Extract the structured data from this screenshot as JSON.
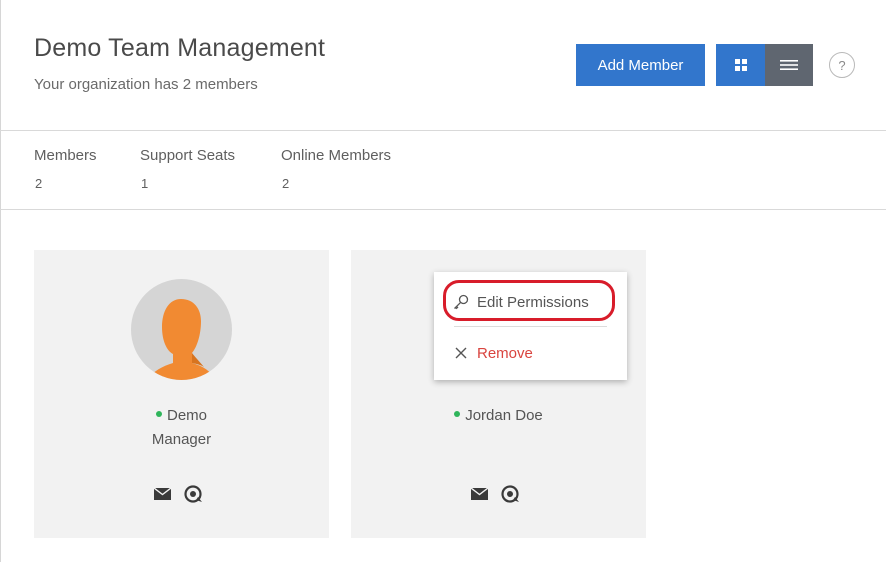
{
  "header": {
    "title": "Demo Team Management",
    "subtitle": "Your organization has 2 members",
    "add_member_label": "Add Member",
    "grid_view_icon": "grid-icon",
    "list_view_icon": "list-icon",
    "help_label": "?"
  },
  "stats": [
    {
      "label": "Members",
      "value": "2"
    },
    {
      "label": "Support Seats",
      "value": "1"
    },
    {
      "label": "Online Members",
      "value": "2"
    }
  ],
  "members": [
    {
      "name": "Demo",
      "role": "Manager",
      "status": "online",
      "actions": [
        "mail-icon",
        "support-icon"
      ]
    },
    {
      "name": "Jordan Doe",
      "status": "online",
      "actions": [
        "mail-icon",
        "support-icon"
      ]
    }
  ],
  "menu": {
    "edit_permissions": "Edit Permissions",
    "remove": "Remove"
  },
  "colors": {
    "primary": "#3276cc",
    "list_toggle": "#5f6670",
    "online": "#2fb55b",
    "danger": "#d9443f",
    "highlight": "#d81c2a",
    "avatar_orange": "#f18a32"
  }
}
